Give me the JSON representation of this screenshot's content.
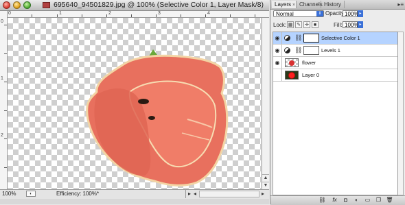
{
  "window": {
    "title": "695640_94501829.jpg @ 100% (Selective Color 1, Layer Mask/8)"
  },
  "rulers": {
    "top_labels": [
      "0",
      "1",
      "2",
      "3",
      "4"
    ],
    "left_labels": [
      "0",
      "1",
      "2"
    ]
  },
  "status": {
    "zoom": "100%",
    "efficiency": "Efficiency: 100%*"
  },
  "panel": {
    "tabs": [
      {
        "label": "Layers",
        "active": true
      },
      {
        "label": "Channels",
        "active": false
      },
      {
        "label": "History",
        "active": false
      }
    ],
    "blend_mode": "Normal",
    "opacity_label": "Opacity:",
    "opacity_value": "100%",
    "lock_label": "Lock:",
    "fill_label": "Fill:",
    "fill_value": "100%",
    "layers": [
      {
        "name": "Selective Color 1",
        "type": "adjustment",
        "visible": true,
        "selected": true
      },
      {
        "name": "Levels 1",
        "type": "adjustment",
        "visible": true,
        "selected": false
      },
      {
        "name": "flower",
        "type": "pixel",
        "visible": true,
        "selected": false
      },
      {
        "name": "Layer 0",
        "type": "pixel",
        "visible": false,
        "selected": false
      }
    ],
    "footer_icons": [
      "link-icon",
      "fx-icon",
      "mask-icon",
      "adjustment-icon",
      "folder-icon",
      "new-layer-icon",
      "trash-icon"
    ]
  },
  "colors": {
    "selected_row": "#b5d3ff",
    "flower": "#e8705e"
  }
}
